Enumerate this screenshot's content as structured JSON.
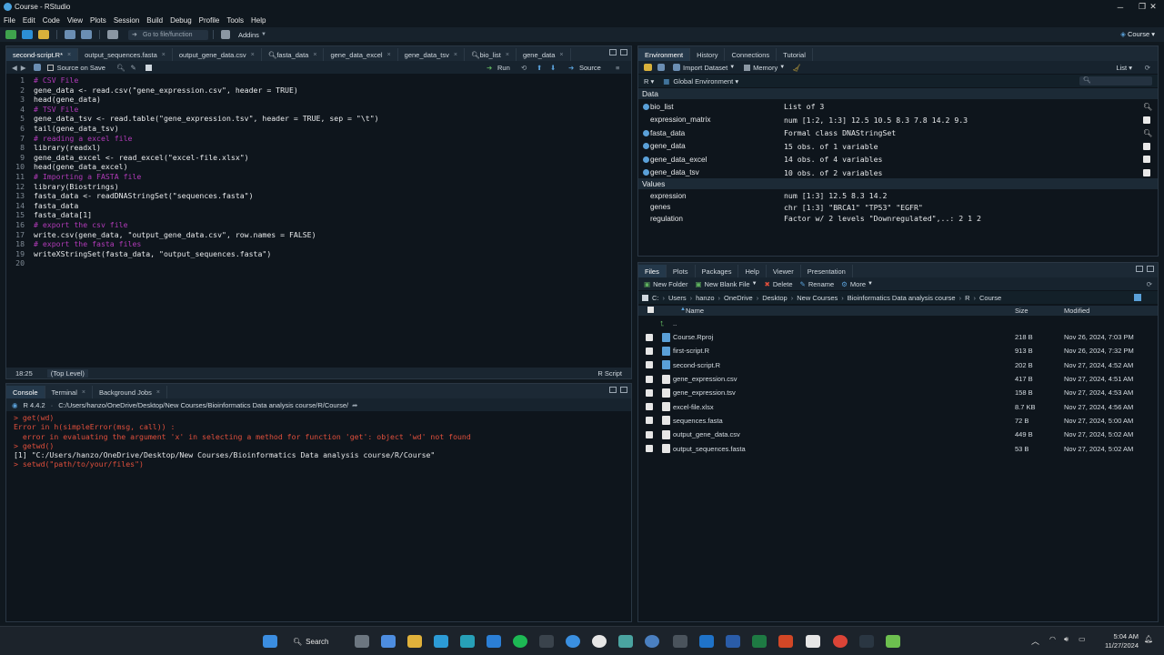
{
  "window": {
    "title": "Course - RStudio"
  },
  "menu": [
    "File",
    "Edit",
    "Code",
    "View",
    "Plots",
    "Session",
    "Build",
    "Debug",
    "Profile",
    "Tools",
    "Help"
  ],
  "toolbar": {
    "goto_label": "Go to file/function",
    "addins": "Addins",
    "project": "Course"
  },
  "editor": {
    "tabs": [
      "second-script.R*",
      "output_sequences.fasta",
      "output_gene_data.csv",
      "fasta_data",
      "gene_data_excel",
      "gene_data_tsv",
      "bio_list",
      "gene_data"
    ],
    "source_on_save": "Source on Save",
    "run": "Run",
    "source": "Source",
    "lines": [
      {
        "n": "1",
        "t": "# CSV File",
        "c": "cm"
      },
      {
        "n": "2",
        "t": "gene_data <- read.csv(\"gene_expression.csv\", header = TRUE)",
        "c": "cd"
      },
      {
        "n": "3",
        "t": "head(gene_data)",
        "c": "cd"
      },
      {
        "n": "4",
        "t": "# TSV File",
        "c": "cm"
      },
      {
        "n": "5",
        "t": "gene_data_tsv <- read.table(\"gene_expression.tsv\", header = TRUE, sep = \"\\t\")",
        "c": "cd"
      },
      {
        "n": "6",
        "t": "tail(gene_data_tsv)",
        "c": "cd"
      },
      {
        "n": "7",
        "t": "# reading a excel file",
        "c": "cm"
      },
      {
        "n": "8",
        "t": "library(readxl)",
        "c": "cd"
      },
      {
        "n": "9",
        "t": "gene_data_excel <- read_excel(\"excel-file.xlsx\")",
        "c": "cd"
      },
      {
        "n": "10",
        "t": "head(gene_data_excel)",
        "c": "cd"
      },
      {
        "n": "11",
        "t": "# Importing a FASTA file",
        "c": "cm"
      },
      {
        "n": "12",
        "t": "library(Biostrings)",
        "c": "cd"
      },
      {
        "n": "13",
        "t": "fasta_data <- readDNAStringSet(\"sequences.fasta\")",
        "c": "cd"
      },
      {
        "n": "14",
        "t": "fasta_data",
        "c": "cd"
      },
      {
        "n": "15",
        "t": "fasta_data[1]",
        "c": "cd"
      },
      {
        "n": "16",
        "t": "# export the csv file",
        "c": "cm"
      },
      {
        "n": "17",
        "t": "write.csv(gene_data, \"output_gene_data.csv\", row.names = FALSE)",
        "c": "cd"
      },
      {
        "n": "18",
        "t": "# export the fasta files",
        "c": "cm"
      },
      {
        "n": "19",
        "t": "writeXStringSet(fasta_data, \"output_sequences.fasta\")",
        "c": "cd"
      },
      {
        "n": "20",
        "t": "",
        "c": "cd"
      }
    ],
    "status_pos": "18:25",
    "status_scope": "(Top Level)",
    "status_type": "R Script"
  },
  "console": {
    "tabs": [
      "Console",
      "Terminal",
      "Background Jobs"
    ],
    "version": "R 4.4.2",
    "path": "C:/Users/hanzo/OneDrive/Desktop/New Courses/Bioinformatics Data analysis course/R/Course/",
    "lines": [
      {
        "t": "> get(wd)",
        "c": "cprompt"
      },
      {
        "t": "Error in h(simpleError(msg, call)) :",
        "c": "cerr"
      },
      {
        "t": "  error in evaluating the argument 'x' in selecting a method for function 'get': object 'wd' not found",
        "c": "cerr"
      },
      {
        "t": "> getwd()",
        "c": "cprompt"
      },
      {
        "t": "[1] \"C:/Users/hanzo/OneDrive/Desktop/New Courses/Bioinformatics Data analysis course/R/Course\"",
        "c": "cout"
      },
      {
        "t": "> setwd(\"path/to/your/files\")",
        "c": "cprompt"
      }
    ]
  },
  "environment": {
    "tabs": [
      "Environment",
      "History",
      "Connections",
      "Tutorial"
    ],
    "import": "Import Dataset",
    "memory": "Memory",
    "list": "List",
    "lang": "R",
    "scope": "Global Environment",
    "data_header": "Data",
    "values_header": "Values",
    "data": [
      {
        "name": "bio_list",
        "value": "List of  3",
        "dot": true
      },
      {
        "name": "expression_matrix",
        "value": "num [1:2, 1:3] 12.5 10.5 8.3 7.8 14.2 9.3",
        "dot": false
      },
      {
        "name": "fasta_data",
        "value": "Formal class  DNAStringSet",
        "dot": true
      },
      {
        "name": "gene_data",
        "value": "15 obs. of 1 variable",
        "dot": true
      },
      {
        "name": "gene_data_excel",
        "value": "14 obs. of 4 variables",
        "dot": true
      },
      {
        "name": "gene_data_tsv",
        "value": "10 obs. of 2 variables",
        "dot": true
      }
    ],
    "values": [
      {
        "name": "expression",
        "value": "num [1:3] 12.5 8.3 14.2"
      },
      {
        "name": "genes",
        "value": "chr [1:3] \"BRCA1\" \"TP53\" \"EGFR\""
      },
      {
        "name": "regulation",
        "value": "Factor w/ 2 levels \"Downregulated\",..: 2 1 2"
      }
    ]
  },
  "files": {
    "tabs": [
      "Files",
      "Plots",
      "Packages",
      "Help",
      "Viewer",
      "Presentation"
    ],
    "actions": [
      "New Folder",
      "New Blank File",
      "Delete",
      "Rename",
      "More"
    ],
    "breadcrumb": [
      "C:",
      "Users",
      "hanzo",
      "OneDrive",
      "Desktop",
      "New Courses",
      "Bioinformatics Data analysis course",
      "R",
      "Course"
    ],
    "col_name": "Name",
    "col_size": "Size",
    "col_modified": "Modified",
    "up": "..",
    "rows": [
      {
        "name": "Course.Rproj",
        "size": "218 B",
        "modified": "Nov 26, 2024, 7:03 PM"
      },
      {
        "name": "first-script.R",
        "size": "913 B",
        "modified": "Nov 26, 2024, 7:32 PM"
      },
      {
        "name": "second-script.R",
        "size": "202 B",
        "modified": "Nov 27, 2024, 4:52 AM"
      },
      {
        "name": "gene_expression.csv",
        "size": "417 B",
        "modified": "Nov 27, 2024, 4:51 AM"
      },
      {
        "name": "gene_expression.tsv",
        "size": "158 B",
        "modified": "Nov 27, 2024, 4:53 AM"
      },
      {
        "name": "excel-file.xlsx",
        "size": "8.7 KB",
        "modified": "Nov 27, 2024, 4:56 AM"
      },
      {
        "name": "sequences.fasta",
        "size": "72 B",
        "modified": "Nov 27, 2024, 5:00 AM"
      },
      {
        "name": "output_gene_data.csv",
        "size": "449 B",
        "modified": "Nov 27, 2024, 5:02 AM"
      },
      {
        "name": "output_sequences.fasta",
        "size": "53 B",
        "modified": "Nov 27, 2024, 5:02 AM"
      }
    ]
  },
  "taskbar": {
    "search": "Search",
    "time": "5:04 AM",
    "date": "11/27/2024"
  }
}
